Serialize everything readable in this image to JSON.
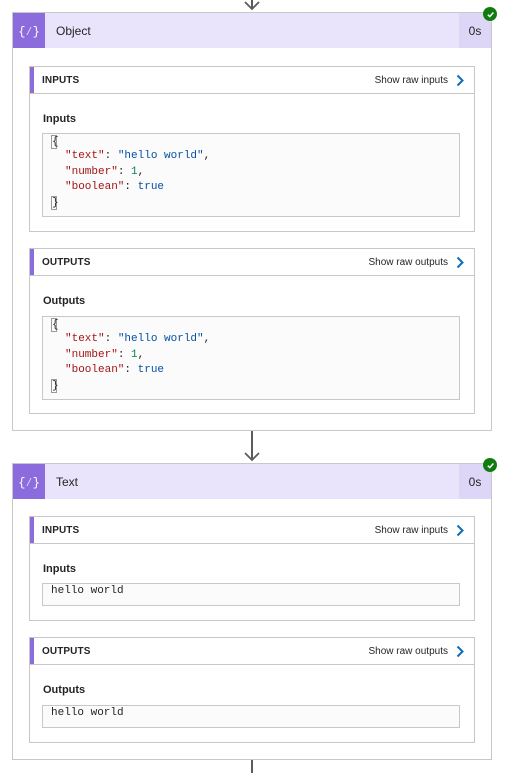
{
  "colors": {
    "accent": "#8c6cdc",
    "header_bg": "#e9e4fb",
    "success": "#107c10",
    "link_arrow": "#0f6cbd"
  },
  "actions": [
    {
      "title": "Object",
      "duration": "0s",
      "icon": "curly-braces-icon",
      "status_icon": "check-circle-icon",
      "inputs": {
        "header": "INPUTS",
        "raw_link": "Show raw inputs",
        "label": "Inputs",
        "json": {
          "open": "{",
          "close": "}",
          "lines": [
            {
              "key": "\"text\"",
              "value": "\"hello world\"",
              "trail": ","
            },
            {
              "key": "\"number\"",
              "value": "1",
              "trail": ","
            },
            {
              "key": "\"boolean\"",
              "value": "true",
              "trail": ""
            }
          ]
        }
      },
      "outputs": {
        "header": "OUTPUTS",
        "raw_link": "Show raw outputs",
        "label": "Outputs",
        "json": {
          "open": "{",
          "close": "}",
          "lines": [
            {
              "key": "\"text\"",
              "value": "\"hello world\"",
              "trail": ","
            },
            {
              "key": "\"number\"",
              "value": "1",
              "trail": ","
            },
            {
              "key": "\"boolean\"",
              "value": "true",
              "trail": ""
            }
          ]
        }
      }
    },
    {
      "title": "Text",
      "duration": "0s",
      "icon": "curly-braces-icon",
      "status_icon": "check-circle-icon",
      "inputs": {
        "header": "INPUTS",
        "raw_link": "Show raw inputs",
        "label": "Inputs",
        "value": "hello world"
      },
      "outputs": {
        "header": "OUTPUTS",
        "raw_link": "Show raw outputs",
        "label": "Outputs",
        "value": "hello world"
      }
    }
  ]
}
